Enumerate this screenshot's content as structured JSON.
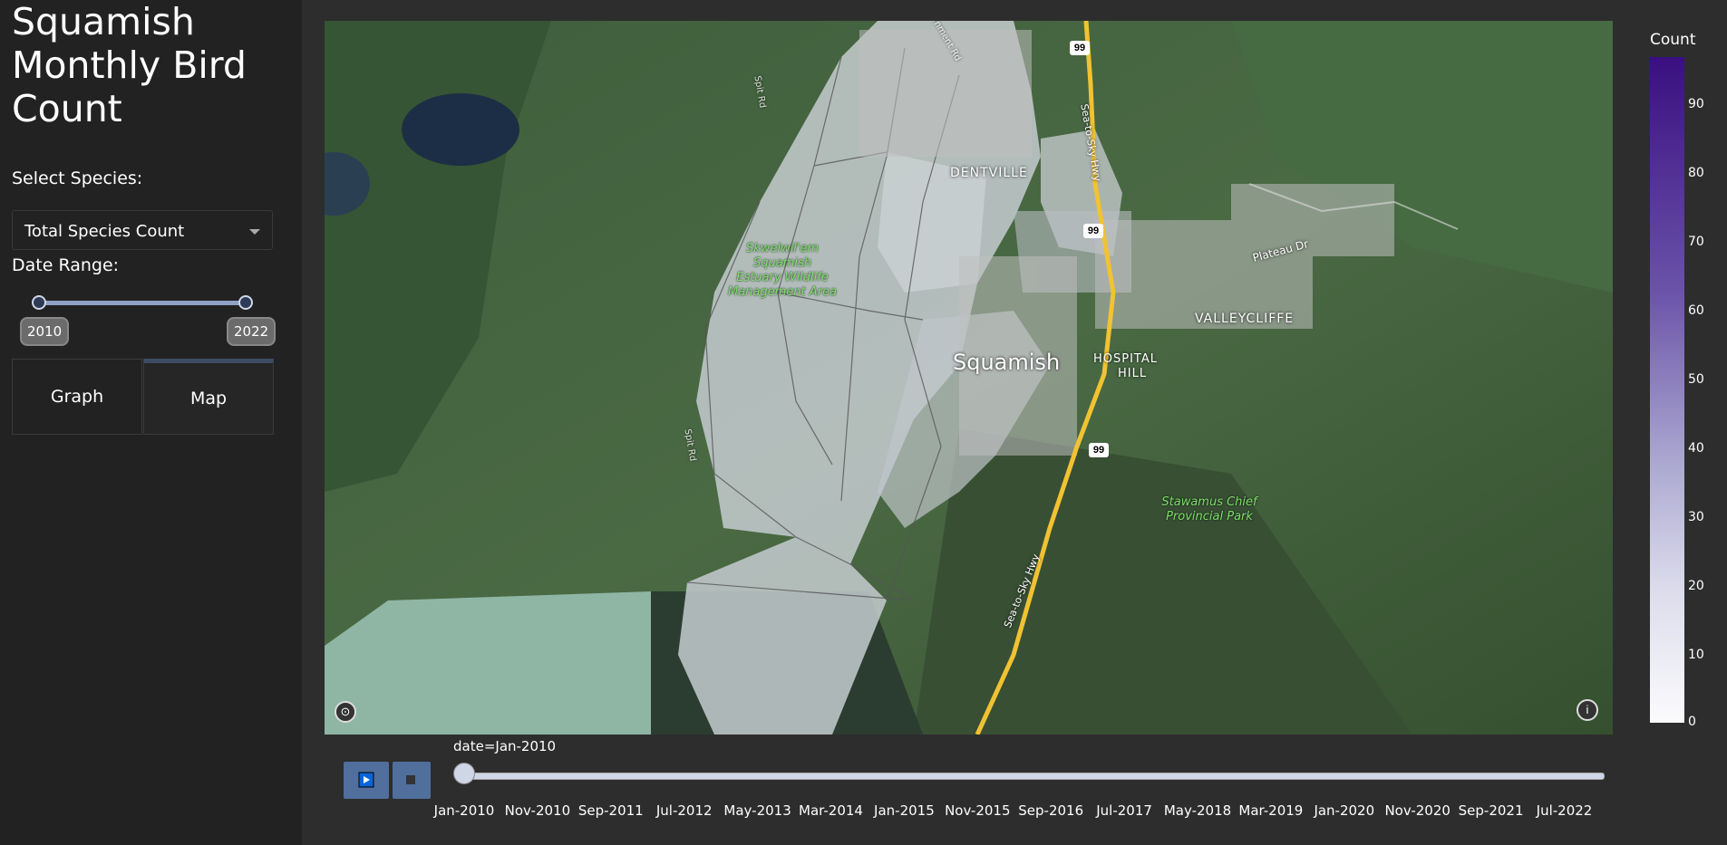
{
  "app": {
    "title": "Squamish Monthly Bird Count"
  },
  "sidebar": {
    "species_label": "Select Species:",
    "species_selected": "Total Species Count",
    "date_range_label": "Date Range:",
    "date_range": {
      "min_label": "2010",
      "max_label": "2022",
      "start": 2010,
      "end": 2022
    },
    "tabs": [
      {
        "label": "Graph",
        "active": false
      },
      {
        "label": "Map",
        "active": true
      }
    ]
  },
  "map": {
    "labels": {
      "dentville": "DENTVILLE",
      "squamish": "Squamish",
      "hospital_hill_1": "HOSPITAL",
      "hospital_hill_2": "HILL",
      "valleycliffe": "VALLEYCLIFFE",
      "estuary": [
        "Skwelwil'em",
        "Squamish",
        "Estuary Wildlife",
        "Management Area"
      ],
      "stawamus": [
        "Stawamus Chief",
        "Provincial Park"
      ],
      "plateau_dr": "Plateau Dr",
      "highway": "Sea-to-Sky Hwy",
      "highway_number": "99",
      "spit_rd": "Spit Rd",
      "government_rd": "Government Rd"
    }
  },
  "colorbar": {
    "title": "Count",
    "ticks": [
      "90",
      "80",
      "70",
      "60",
      "50",
      "40",
      "30",
      "20",
      "10",
      "0"
    ],
    "colors": {
      "max": "#3a0f80",
      "min": "#fbfbfd"
    }
  },
  "animation": {
    "label": "date=Jan-2010",
    "current_index": 0,
    "ticks": [
      "Jan-2010",
      "Nov-2010",
      "Sep-2011",
      "Jul-2012",
      "May-2013",
      "Mar-2014",
      "Jan-2015",
      "Nov-2015",
      "Sep-2016",
      "Jul-2017",
      "May-2018",
      "Mar-2019",
      "Jan-2020",
      "Nov-2020",
      "Sep-2021",
      "Jul-2022"
    ]
  }
}
